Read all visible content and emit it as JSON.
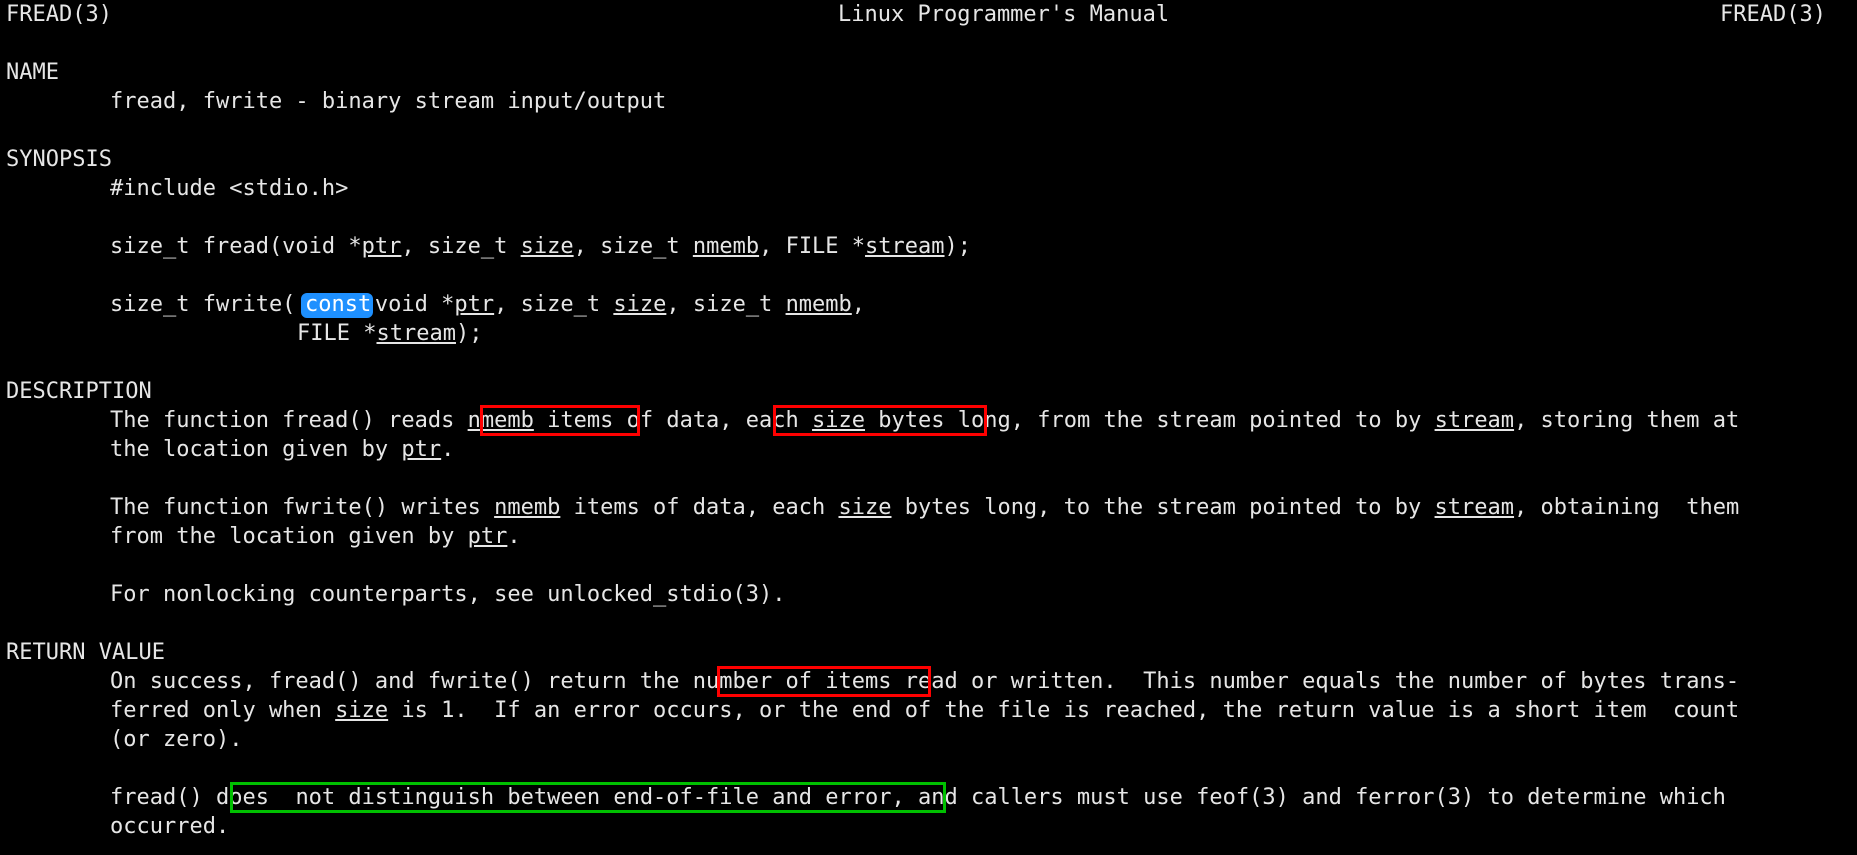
{
  "terminal": {
    "background_color": "#000000",
    "foreground_color": "#e6e6e6",
    "title_left": "FREAD(3)",
    "title_center": "Linux Programmer's Manual",
    "title_right": "FREAD(3)"
  },
  "annotations": {
    "red_color": "#ff0000",
    "green_color": "#00c000",
    "blue_color": "#1e90ff",
    "boxes": [
      {
        "name": "const-highlight",
        "color": "#1e90ff",
        "text": "const"
      },
      {
        "name": "nmemb-items-box",
        "color": "#ff0000",
        "text": "nmemb items"
      },
      {
        "name": "each-size-bytes-box",
        "color": "#ff0000",
        "text": "each size bytes"
      },
      {
        "name": "number-of-items-box",
        "color": "#ff0000",
        "text": "number of items"
      },
      {
        "name": "eof-error-box",
        "color": "#00c000",
        "text": "does  not distinguish between end-of-file and error"
      }
    ]
  },
  "sections": {
    "name": {
      "heading": "NAME",
      "body": "fread, fwrite - binary stream input/output"
    },
    "synopsis": {
      "heading": "SYNOPSIS",
      "include": "#include <stdio.h>",
      "fread_pre": "size_t fread(void *",
      "fread_ptr": "ptr",
      "fread_mid1": ", size_t ",
      "fread_size": "size",
      "fread_mid2": ", size_t ",
      "fread_nmemb": "nmemb",
      "fread_mid3": ", FILE *",
      "fread_stream": "stream",
      "fread_end": ");",
      "fwrite_pre": "size_t fwrite(",
      "fwrite_const": "const",
      "fwrite_after_const": " void *",
      "fwrite_ptr": "ptr",
      "fwrite_mid1": ", size_t ",
      "fwrite_size": "size",
      "fwrite_mid2": ", size_t ",
      "fwrite_nmemb": "nmemb",
      "fwrite_comma": ",",
      "fwrite_cont_pre": "FILE *",
      "fwrite_cont_stream": "stream",
      "fwrite_cont_end": ");"
    },
    "description": {
      "heading": "DESCRIPTION",
      "p1_a": "The function fread() reads ",
      "p1_box1_u": "nmemb",
      "p1_box1_rest": " items",
      "p1_b": " of data, ",
      "p1_box2_a": "each ",
      "p1_box2_u": "size",
      "p1_box2_b": " bytes",
      "p1_c": " long, from the stream pointed to by ",
      "p1_stream": "stream",
      "p1_d": ", storing them at",
      "p1_line2_a": "the location given by ",
      "p1_line2_ptr": "ptr",
      "p1_line2_b": ".",
      "p2_a": "The function fwrite() writes ",
      "p2_nmemb": "nmemb",
      "p2_b": " items of data, each ",
      "p2_size": "size",
      "p2_c": " bytes long, to the stream pointed to by ",
      "p2_stream": "stream",
      "p2_d": ", obtaining  them",
      "p2_line2_a": "from the location given by ",
      "p2_line2_ptr": "ptr",
      "p2_line2_b": ".",
      "p3": "For nonlocking counterparts, see unlocked_stdio(3)."
    },
    "return_value": {
      "heading": "RETURN VALUE",
      "p1_a": "On success, fread() and fwrite() return the ",
      "p1_box": "number of items",
      "p1_b": " read or written.  This number equals the number of bytes trans-",
      "p1_line2_a": "ferred only when ",
      "p1_line2_size": "size",
      "p1_line2_b": " is 1.  If an error occurs, or the end of the file is reached, the return value is a short item  count",
      "p1_line3": "(or zero).",
      "p2_a": "fread() ",
      "p2_box": "does  not distinguish between end-of-file and error",
      "p2_b": ", and callers must use feof(3) and ferror(3) to determine which",
      "p2_line2": "occurred."
    }
  }
}
